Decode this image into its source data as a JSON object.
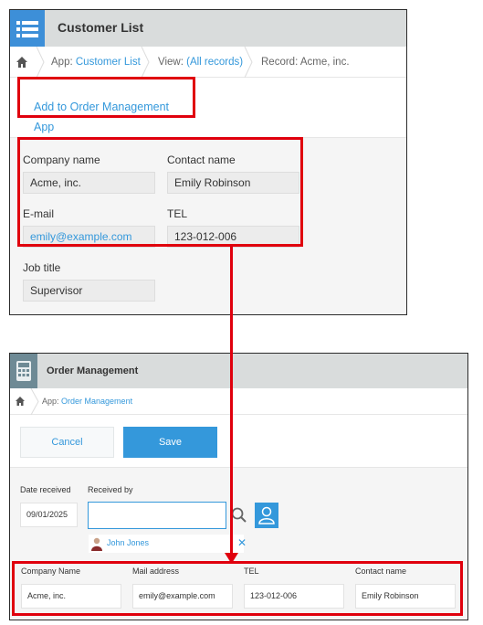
{
  "customer_list": {
    "title": "Customer List",
    "breadcrumb": {
      "app_prefix": "App:",
      "app_name": "Customer List",
      "view_prefix": "View:",
      "view_name": "(All records)",
      "record": "Record: Acme, inc."
    },
    "action_button": "Add to Order Management App",
    "fields": {
      "company_name": {
        "label": "Company name",
        "value": "Acme, inc."
      },
      "contact_name": {
        "label": "Contact name",
        "value": "Emily Robinson"
      },
      "email": {
        "label": "E-mail",
        "value": "emily@example.com"
      },
      "tel": {
        "label": "TEL",
        "value": "123-012-006"
      },
      "job_title": {
        "label": "Job title",
        "value": "Supervisor"
      }
    }
  },
  "order_management": {
    "title": "Order Management",
    "breadcrumb": {
      "app_prefix": "App:",
      "app_name": "Order Management"
    },
    "cancel_label": "Cancel",
    "save_label": "Save",
    "date_received": {
      "label": "Date received",
      "value": "09/01/2025"
    },
    "received_by": {
      "label": "Received by",
      "value": "",
      "user": "John Jones"
    },
    "fields": {
      "company_name": {
        "label": "Company Name",
        "value": "Acme, inc."
      },
      "mail_address": {
        "label": "Mail address",
        "value": "emily@example.com"
      },
      "tel": {
        "label": "TEL",
        "value": "123-012-006"
      },
      "contact_name": {
        "label": "Contact name",
        "value": "Emily Robinson"
      }
    }
  },
  "colors": {
    "accent": "#3498db",
    "highlight": "#e0000d",
    "header": "#d9dcdc",
    "app_icon_customer": "#3d8fd8",
    "app_icon_order": "#6e8a95"
  },
  "icons": [
    "list-app-icon",
    "home-icon",
    "phone-app-icon",
    "search-icon",
    "user-picker-icon",
    "user-avatar-icon",
    "remove-icon"
  ]
}
